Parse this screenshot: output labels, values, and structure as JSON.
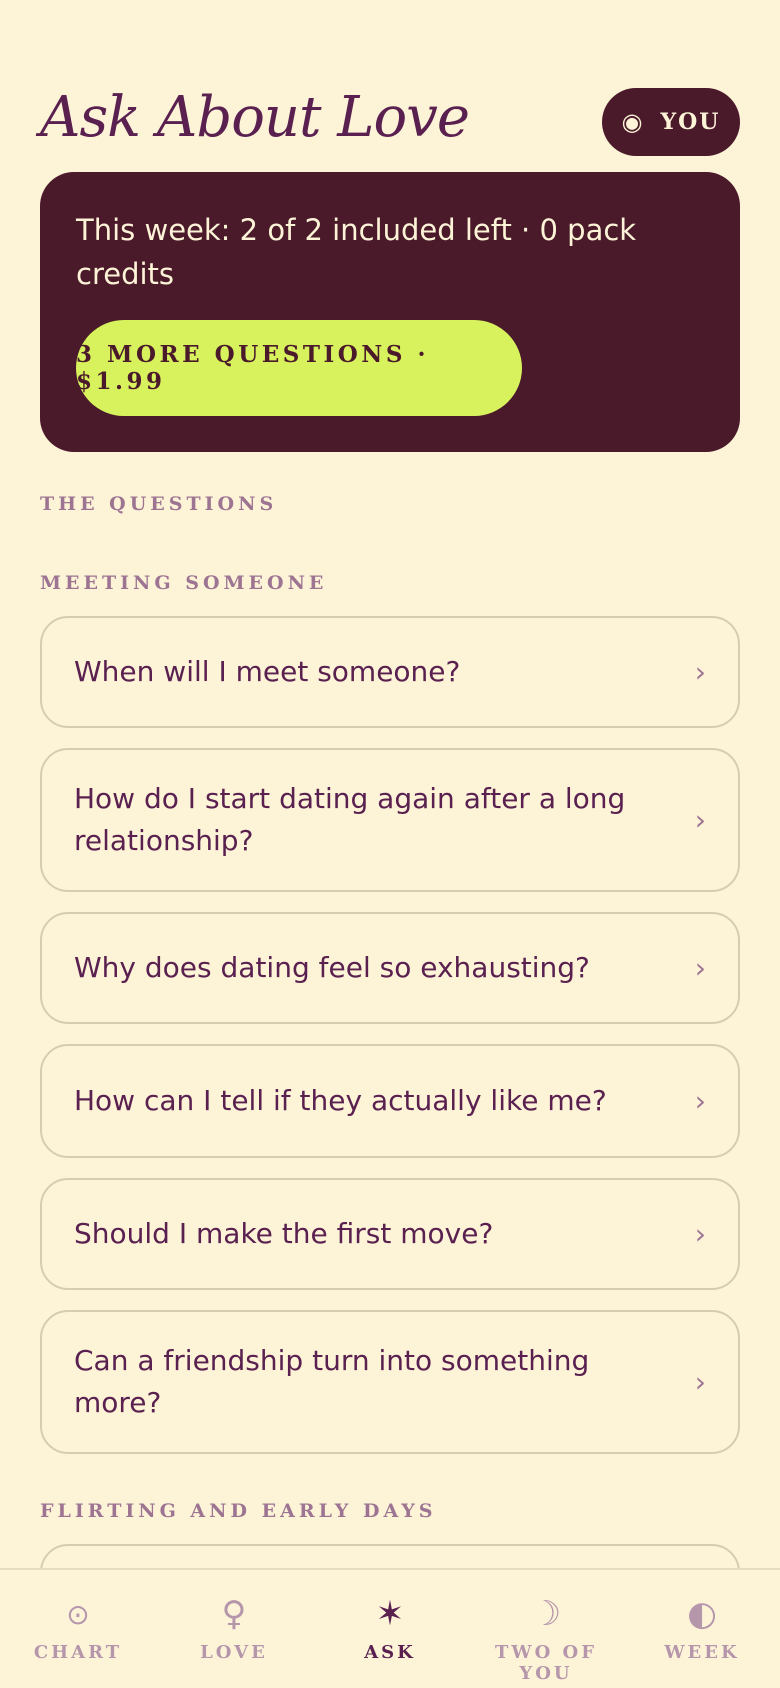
{
  "header": {
    "title": "Ask About Love",
    "profile_button": {
      "icon": "sun-icon",
      "glyph": "◉",
      "label": "YOU"
    }
  },
  "credits": {
    "status_text": "This week: 2 of 2 included left · 0 pack credits",
    "buy_button_label": "3 MORE QUESTIONS · $1.99"
  },
  "questions": {
    "heading": "THE QUESTIONS",
    "sections": [
      {
        "title": "MEETING SOMEONE",
        "items": [
          "When will I meet someone?",
          "How do I start dating again after a long relationship?",
          "Why does dating feel so exhausting?",
          "How can I tell if they actually like me?",
          "Should I make the first move?",
          "Can a friendship turn into something more?"
        ]
      },
      {
        "title": "FLIRTING AND EARLY DAYS",
        "items": []
      }
    ],
    "chevron": "›"
  },
  "tabs": [
    {
      "label": "CHART",
      "icon": "sun-circle-icon",
      "glyph": "⊙",
      "active": false
    },
    {
      "label": "LOVE",
      "icon": "venus-icon",
      "glyph": "♀",
      "active": false
    },
    {
      "label": "ASK",
      "icon": "star-icon",
      "glyph": "✶",
      "active": true
    },
    {
      "label": "TWO OF YOU",
      "icon": "moon-icon",
      "glyph": "☽",
      "active": false
    },
    {
      "label": "WEEK",
      "icon": "half-circle-icon",
      "glyph": "◐",
      "active": false
    }
  ],
  "colors": {
    "background": "#fdf4d8",
    "plum": "#5a2150",
    "dark_card": "#4a1a2a",
    "lime": "#d8f25e",
    "muted": "#9d7491"
  }
}
